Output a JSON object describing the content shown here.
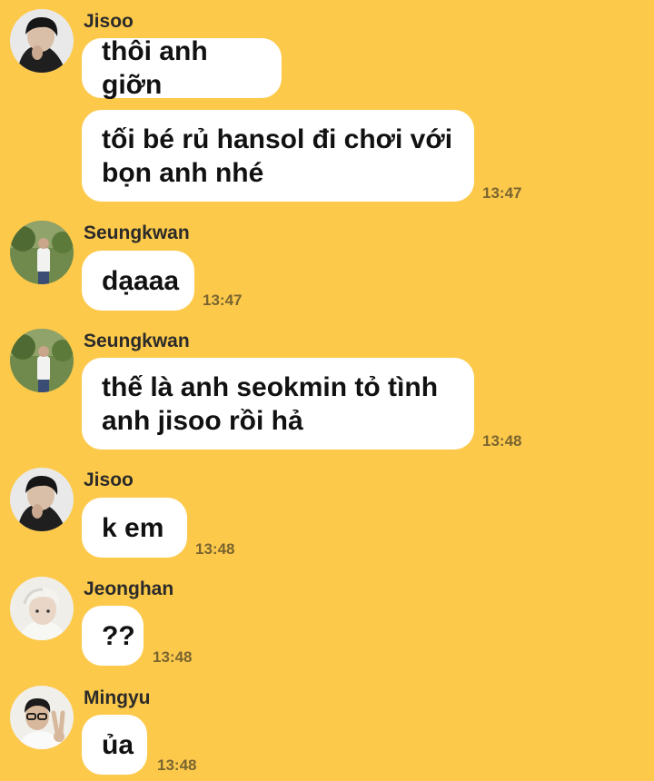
{
  "colors": {
    "background": "#FCC94B",
    "bubble": "#FFFFFF",
    "timestamp": "#7A6530"
  },
  "messages": [
    {
      "sender": "Jisoo",
      "avatar": "jisoo-avatar",
      "lines": [
        "thôi anh giỡn"
      ],
      "time": ""
    },
    {
      "sender": "",
      "avatar": "",
      "lines": [
        "tối bé rủ hansol đi chơi với",
        "bọn anh nhé"
      ],
      "time": "13:47"
    },
    {
      "sender": "Seungkwan",
      "avatar": "seungkwan-avatar",
      "lines": [
        "dạaaa"
      ],
      "time": "13:47"
    },
    {
      "sender": "Seungkwan",
      "avatar": "seungkwan-avatar",
      "lines": [
        "thế là anh seokmin tỏ tình",
        "anh jisoo rồi hả"
      ],
      "time": "13:48"
    },
    {
      "sender": "Jisoo",
      "avatar": "jisoo-avatar",
      "lines": [
        "k em"
      ],
      "time": "13:48"
    },
    {
      "sender": "Jeonghan",
      "avatar": "jeonghan-avatar",
      "lines": [
        "??"
      ],
      "time": "13:48"
    },
    {
      "sender": "Mingyu",
      "avatar": "mingyu-avatar",
      "lines": [
        "ủa"
      ],
      "time": "13:48"
    }
  ]
}
